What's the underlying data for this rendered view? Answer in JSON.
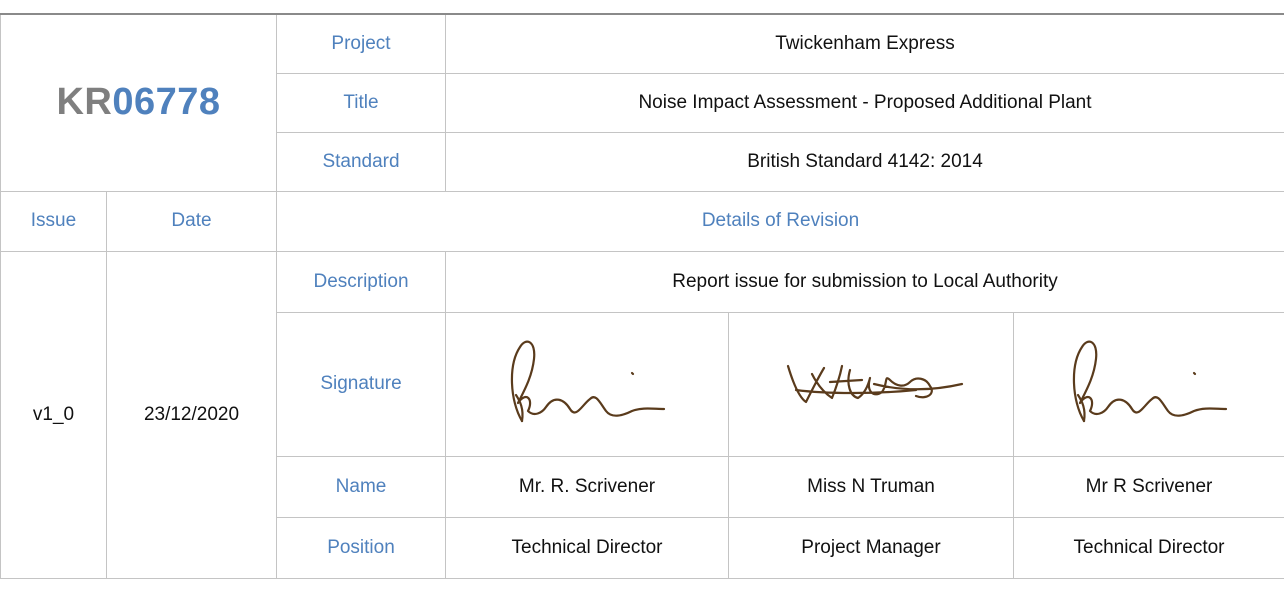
{
  "header": {
    "ref_prefix": "KR",
    "ref_number": "06778",
    "project_label": "Project",
    "project_value": "Twickenham Express",
    "title_label": "Title",
    "title_value": "Noise Impact Assessment - Proposed Additional Plant",
    "standard_label": "Standard",
    "standard_value": "British Standard 4142: 2014"
  },
  "revision_header": {
    "issue_label": "Issue",
    "date_label": "Date",
    "details_label": "Details of Revision"
  },
  "revision": {
    "issue": "v1_0",
    "date": "23/12/2020",
    "description_label": "Description",
    "description_value": "Report issue for submission to Local Authority",
    "signature_label": "Signature",
    "name_label": "Name",
    "position_label": "Position",
    "signatories": [
      {
        "name": "Mr. R. Scrivener",
        "position": "Technical Director",
        "signature_icon": "signature-r-scrivener"
      },
      {
        "name": "Miss N Truman",
        "position": "Project Manager",
        "signature_icon": "signature-n-truman"
      },
      {
        "name": "Mr R Scrivener",
        "position": "Technical Director",
        "signature_icon": "signature-r-scrivener"
      }
    ]
  },
  "colors": {
    "label_blue": "#4f81bd",
    "ref_grey": "#7f7f7f",
    "border": "#c4c4c4",
    "signature_ink": "#5a3b1c"
  }
}
